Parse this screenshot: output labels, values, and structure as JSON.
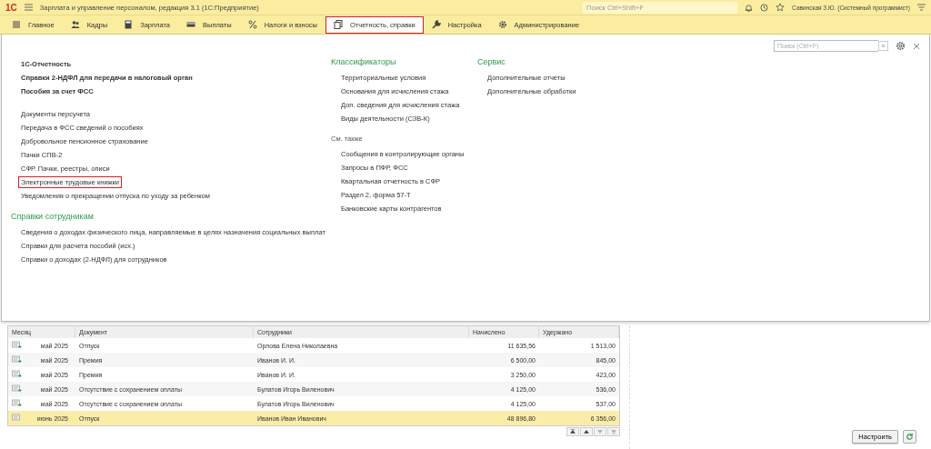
{
  "app": {
    "logo": "1С",
    "title": "Зарплата и управление персоналом, редакция 3.1  (1С:Предприятие)",
    "search": {
      "placeholder": "Поиск Ctrl+Shift+F"
    },
    "user": "Савинская З.Ю. (Системный программист)"
  },
  "sections": [
    {
      "label": "Главное",
      "selected": false,
      "highlighted": false
    },
    {
      "label": "Кадры",
      "selected": false,
      "highlighted": false
    },
    {
      "label": "Зарплата",
      "selected": false,
      "highlighted": false
    },
    {
      "label": "Выплаты",
      "selected": false,
      "highlighted": false
    },
    {
      "label": "Налоги и взносы",
      "selected": false,
      "highlighted": false
    },
    {
      "label": "Отчетность, справки",
      "selected": true,
      "highlighted": true
    },
    {
      "label": "Настройка",
      "selected": false,
      "highlighted": false
    },
    {
      "label": "Администрирование",
      "selected": false,
      "highlighted": false
    }
  ],
  "panel": {
    "search": {
      "placeholder": "Поиск (Ctrl+F)"
    },
    "columns": [
      [
        {
          "bold": true,
          "items": [
            {
              "label": "1С-Отчетность",
              "highlighted": false
            },
            {
              "label": "Справки 2-НДФЛ для передачи в налоговый орган",
              "highlighted": false
            },
            {
              "label": "Пособия за счет ФСС",
              "highlighted": false
            }
          ]
        },
        {
          "bold": false,
          "items": [
            {
              "label": "Документы персучета",
              "highlighted": false
            },
            {
              "label": "Передача в ФСС сведений о пособиях",
              "highlighted": false
            },
            {
              "label": "Добровольное пенсионное страхование",
              "highlighted": false
            },
            {
              "label": "Пачки СПВ-2",
              "highlighted": false
            },
            {
              "label": "СФР. Пачки, реестры, описи",
              "highlighted": false
            },
            {
              "label": "Электронные трудовые книжки",
              "highlighted": true
            },
            {
              "label": "Уведомления о прекращении отпуска по уходу за ребенком",
              "highlighted": false
            }
          ]
        },
        {
          "heading": "Справки сотрудникам",
          "kind": "section",
          "bold": false,
          "items": [
            {
              "label": "Сведения о доходах физического лица, направляемые в целях назначения социальных выплат",
              "highlighted": false
            },
            {
              "label": "Справки для расчета пособий (исх.)",
              "highlighted": false
            },
            {
              "label": "Справки о доходах (2-НДФЛ) для сотрудников",
              "highlighted": false
            }
          ]
        }
      ],
      [
        {
          "heading": "Классификаторы",
          "kind": "section",
          "bold": false,
          "items": [
            {
              "label": "Территориальные условия",
              "highlighted": false
            },
            {
              "label": "Основания для исчисления стажа",
              "highlighted": false
            },
            {
              "label": "Доп. сведения для исчисления стажа",
              "highlighted": false
            },
            {
              "label": "Виды деятельности (СЗВ-К)",
              "highlighted": false
            }
          ]
        },
        {
          "heading": "См. также",
          "kind": "note",
          "bold": false,
          "items": [
            {
              "label": "Сообщения в контролирующие органы",
              "highlighted": false
            },
            {
              "label": "Запросы в ПФР, ФСС",
              "highlighted": false
            },
            {
              "label": "Квартальная отчетность в СФР",
              "highlighted": false
            },
            {
              "label": "Раздел 2, форма 57-Т",
              "highlighted": false
            },
            {
              "label": "Банковские карты контрагентов",
              "highlighted": false
            }
          ]
        }
      ],
      [
        {
          "heading": "Сервис",
          "kind": "section",
          "bold": false,
          "items": [
            {
              "label": "Дополнительные отчеты",
              "highlighted": false
            },
            {
              "label": "Дополнительные обработки",
              "highlighted": false
            }
          ]
        }
      ]
    ]
  },
  "table": {
    "columns": [
      "Месяц",
      "Документ",
      "Сотрудники",
      "Начислено",
      "Удержано"
    ],
    "rows": [
      {
        "month": "май 2025",
        "document": "Отпуск",
        "employee": "Орлова Елена Николаевна",
        "accrued": "11 635,56",
        "withheld": "1 513,00",
        "posted": true,
        "selected": false
      },
      {
        "month": "май 2025",
        "document": "Премия",
        "employee": "Иванов И. И.",
        "accrued": "6 500,00",
        "withheld": "845,00",
        "posted": true,
        "selected": false
      },
      {
        "month": "май 2025",
        "document": "Премия",
        "employee": "Иванов И. И.",
        "accrued": "3 250,00",
        "withheld": "423,00",
        "posted": true,
        "selected": false
      },
      {
        "month": "май 2025",
        "document": "Отсутствие с сохранением оплаты",
        "employee": "Булатов Игорь Виленович",
        "accrued": "4 125,00",
        "withheld": "536,00",
        "posted": true,
        "selected": false
      },
      {
        "month": "май 2025",
        "document": "Отсутствие с сохранением оплаты",
        "employee": "Булатов Игорь Виленович",
        "accrued": "4 125,00",
        "withheld": "537,00",
        "posted": true,
        "selected": false
      },
      {
        "month": "июнь 2025",
        "document": "Отпуск",
        "employee": "Иванов Иван Иванович",
        "accrued": "48 896,80",
        "withheld": "6 356,00",
        "posted": false,
        "selected": true
      }
    ]
  },
  "actions": {
    "configure": "Настроить"
  }
}
